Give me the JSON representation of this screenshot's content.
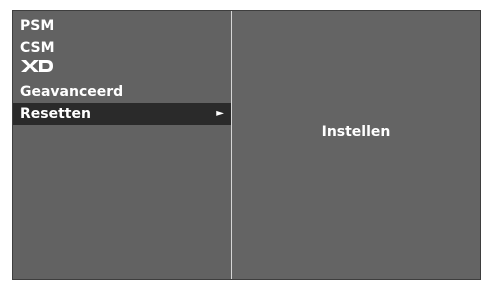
{
  "menu": {
    "items": [
      {
        "label": "PSM",
        "selected": false
      },
      {
        "label": "CSM",
        "selected": false
      },
      {
        "label": "XD",
        "logo": true,
        "selected": false
      },
      {
        "label": "Geavanceerd",
        "selected": false
      },
      {
        "label": "Resetten",
        "selected": true,
        "arrow": "►"
      }
    ]
  },
  "submenu": {
    "label": "Instellen"
  },
  "colors": {
    "panel_bg": "#626262",
    "selected_bg": "#2a2a2a",
    "text": "#ffffff",
    "divider": "#d6d6d6"
  }
}
